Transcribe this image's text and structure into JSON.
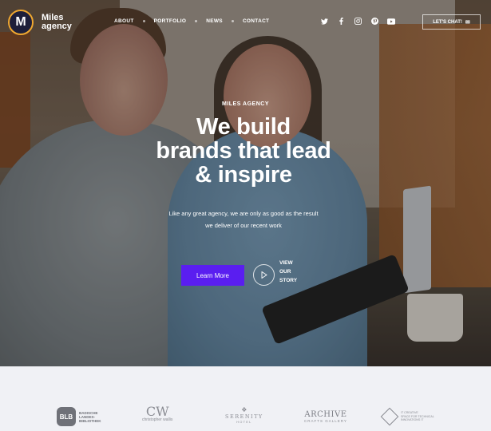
{
  "brand": {
    "initial": "M",
    "name_line1": "Miles",
    "name_line2": "agency"
  },
  "nav": {
    "items": [
      "ABOUT",
      "PORTFOLIO",
      "NEWS",
      "CONTACT"
    ]
  },
  "social": [
    "twitter-icon",
    "facebook-icon",
    "instagram-icon",
    "pinterest-icon",
    "youtube-icon"
  ],
  "header": {
    "chat_label": "LET'S CHAT!"
  },
  "hero": {
    "eyebrow": "MILES AGENCY",
    "headline_l1": "We build",
    "headline_l2": "brands that lead",
    "headline_l3": "& inspire",
    "sub_l1": "Like any great agency, we are only as good as the result",
    "sub_l2": "we deliver of our recent work",
    "cta_label": "Learn More",
    "story_l1": "VIEW",
    "story_l2": "OUR",
    "story_l3": "STORY"
  },
  "clients": {
    "blb_mark": "BLB",
    "blb_l1": "BADISCHE",
    "blb_l2": "LANDES-",
    "blb_l3": "BIBLIOTHEK",
    "cw_mark": "CW",
    "cw_text": "christopher wallis",
    "serenity_l1": "SERENITY",
    "serenity_l2": "HOTEL",
    "archive_l1": "ARCHIVE",
    "archive_l2": "CRAFTS GALLERY",
    "ic_l1": "IT CREATIVE",
    "ic_l2": "SPACE FOR TECHNICAL",
    "ic_l3": "INNOVATIONS IT"
  },
  "colors": {
    "accent": "#5a1ef0",
    "logo_ring": "#f0a830",
    "logo_bg": "#1e1f3a"
  }
}
